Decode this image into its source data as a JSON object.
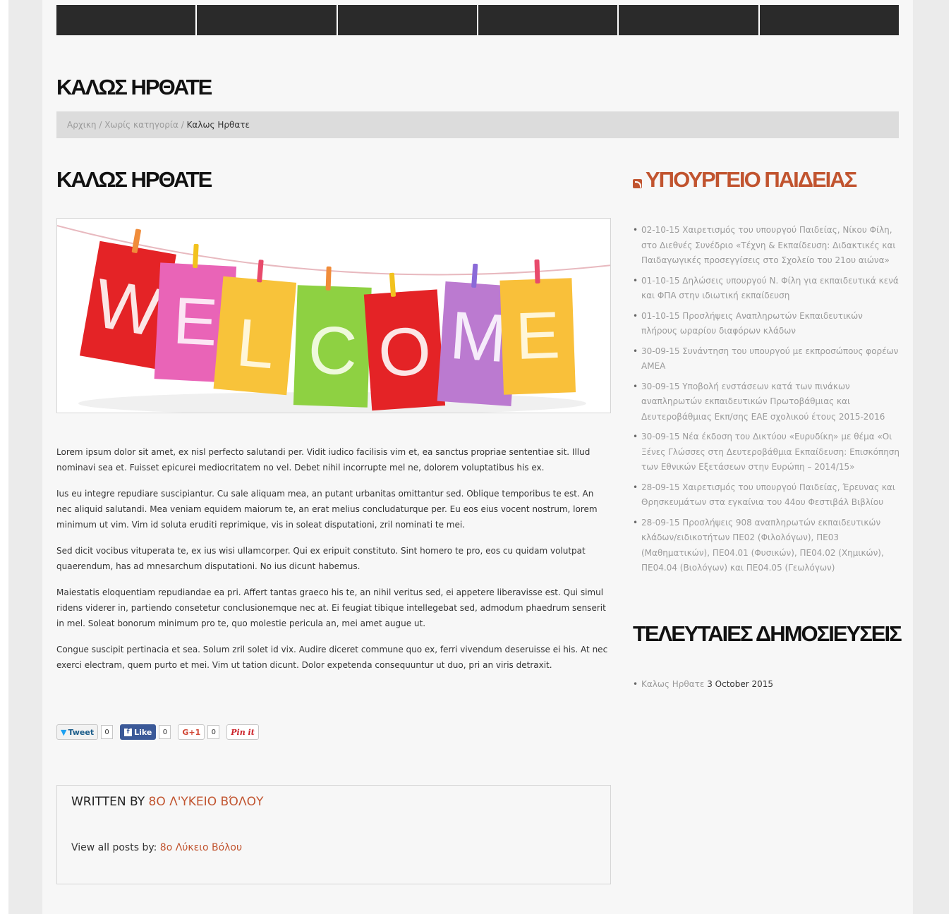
{
  "nav": {
    "items": [
      "",
      "",
      "",
      "",
      "",
      ""
    ]
  },
  "page_title": "ΚΑΛΩΣ ΗΡΘΑΤΕ",
  "breadcrumb": {
    "home": "Αρχικη",
    "category": "Χωρίς κατηγορία",
    "current": "Καλως Ηρθατε",
    "separator": "/"
  },
  "post": {
    "title": "ΚΑΛΩΣ ΗΡΘΑΤΕ",
    "image_letters": [
      "W",
      "E",
      "L",
      "C",
      "O",
      "M",
      "E"
    ],
    "paragraphs": [
      "Lorem ipsum dolor sit amet, ex nisl perfecto salutandi per. Vidit iudico facilisis vim et, ea sanctus propriae sententiae sit. Illud nominavi sea et. Fuisset epicurei mediocritatem no vel. Debet nihil incorrupte mel ne, dolorem voluptatibus his ex.",
      "Ius eu integre repudiare suscipiantur. Cu sale aliquam mea, an putant urbanitas omittantur sed. Oblique temporibus te est. An nec aliquid salutandi. Mea veniam equidem maiorum te, an erat melius concludaturque per. Eu eos eius vocent nostrum, lorem minimum ut vim. Vim id soluta eruditi reprimique, vis in soleat disputationi, zril nominati te mei.",
      "Sed dicit vocibus vituperata te, ex ius wisi ullamcorper. Qui ex eripuit constituto. Sint homero te pro, eos cu quidam volutpat quaerendum, has ad mnesarchum disputationi. No ius dicunt habemus.",
      "Maiestatis eloquentiam repudiandae ea pri. Affert tantas graeco his te, an nihil veritus sed, ei appetere liberavisse est. Qui simul ridens viderer in, partiendo consetetur conclusionemque nec at. Ei feugiat tibique intellegebat sed, admodum phaedrum senserit in mel. Soleat bonorum minimum pro te, quo molestie pericula an, mei amet augue ut.",
      "Congue suscipit pertinacia et sea. Solum zril solet id vix. Audire diceret commune quo ex, ferri vivendum deseruisse ei his. At nec exerci electram, quem purto et mei. Vim ut tation dicunt. Dolor expetenda consequuntur ut duo, pri an viris detraxit."
    ]
  },
  "share": {
    "tweet_label": "Tweet",
    "tweet_count": "0",
    "like_label": "Like",
    "like_count": "0",
    "gplus_label": "G+1",
    "gplus_count": "0",
    "pin_label": "Pin it"
  },
  "author_box": {
    "written_by": "WRITTEN BY",
    "author_name": "8Ο Λ'ΥΚΕΙΟ ΒΌΛΟΥ",
    "view_all_label": "View all posts by:",
    "view_all_link": "8ο Λύκειο Βόλου"
  },
  "sidebar": {
    "ministry_title": "ΥΠΟΥΡΓΕΙΟ ΠΑΙΔΕΙΑΣ",
    "ministry_feed": [
      "02-10-15 Χαιρετισμός του υπουργού Παιδείας, Νίκου Φίλη, στο Διεθνές Συνέδριο «Τέχνη & Εκπαίδευση: Διδακτικές και Παιδαγωγικές προσεγγίσεις στο Σχολείο του 21ου αιώνα»",
      "01-10-15 Δηλώσεις υπουργού Ν. Φίλη για εκπαιδευτικά κενά και ΦΠΑ στην ιδιωτική εκπαίδευση",
      "01-10-15 Προσλήψεις Αναπληρωτών Εκπαιδευτικών πλήρους ωραρίου διαφόρων κλάδων",
      "30-09-15 Συνάντηση του υπουργού με εκπροσώπους φορέων ΑΜΕΑ",
      "30-09-15 Υποβολή ενστάσεων κατά των πινάκων αναπληρωτών εκπαιδευτικών Πρωτοβάθμιας και Δευτεροβάθμιας Εκπ/σης ΕΑΕ σχολικού έτους 2015-2016",
      "30-09-15 Νέα έκδοση του Δικτύου «Ευρυδίκη» με θέμα «Οι Ξένες Γλώσσες στη Δευτεροβάθμια Εκπαίδευση: Επισκόπηση των Εθνικών Εξετάσεων στην Ευρώπη – 2014/15»",
      "28-09-15 Χαιρετισμός του υπουργού Παιδείας, Έρευνας και Θρησκευμάτων στα εγκαίνια του 44ου Φεστιβάλ Βιβλίου",
      "28-09-15 Προσλήψεις 908 αναπληρωτών εκπαιδευτικών κλάδων/ειδικοτήτων ΠΕ02 (Φιλολόγων), ΠΕ03 (Μαθηματικών), ΠΕ04.01 (Φυσικών), ΠΕ04.02 (Χημικών), ΠΕ04.04 (Βιολόγων) και ΠΕ04.05 (Γεωλόγων)"
    ],
    "recent_title": "ΤΕΛΕΥΤΑΙΕΣ ΔΗΜΟΣΙΕΥΣΕΙΣ",
    "recent_posts": [
      {
        "title": "Καλως Ηρθατε",
        "date": "3 October 2015"
      }
    ]
  },
  "colors": {
    "accent": "#c1542f",
    "nav": "#2a2a2a",
    "breadcrumb_bg": "#dcdcdc"
  }
}
